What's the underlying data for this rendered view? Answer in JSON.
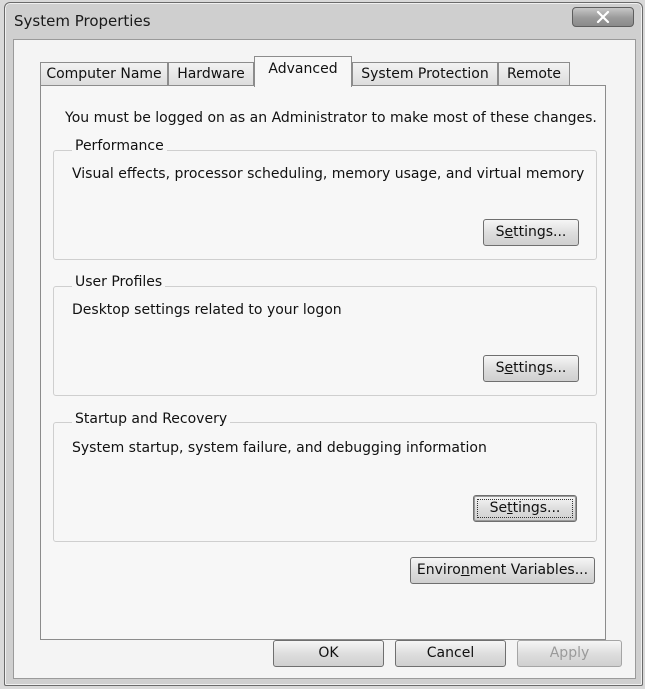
{
  "window": {
    "title": "System Properties"
  },
  "tabs": [
    {
      "label": "Computer Name",
      "active": false
    },
    {
      "label": "Hardware",
      "active": false
    },
    {
      "label": "Advanced",
      "active": true
    },
    {
      "label": "System Protection",
      "active": false
    },
    {
      "label": "Remote",
      "active": false
    }
  ],
  "advanced": {
    "admin_note": "You must be logged on as an Administrator to make most of these changes.",
    "performance": {
      "heading": "Performance",
      "description": "Visual effects, processor scheduling, memory usage, and virtual memory",
      "settings_pre": "S",
      "settings_key": "e",
      "settings_post": "ttings..."
    },
    "user_profiles": {
      "heading": "User Profiles",
      "description": "Desktop settings related to your logon",
      "settings_pre": "S",
      "settings_key": "e",
      "settings_post": "ttings..."
    },
    "startup_recovery": {
      "heading": "Startup and Recovery",
      "description": "System startup, system failure, and debugging information",
      "settings_pre": "Se",
      "settings_key": "t",
      "settings_post": "tings..."
    },
    "env_button": {
      "pre": "Enviro",
      "key": "n",
      "post": "ment Variables..."
    }
  },
  "footer": {
    "ok_label": "OK",
    "cancel_label": "Cancel",
    "apply_label": "Apply",
    "apply_enabled": false
  },
  "icons": {
    "close": "close-x-icon"
  }
}
